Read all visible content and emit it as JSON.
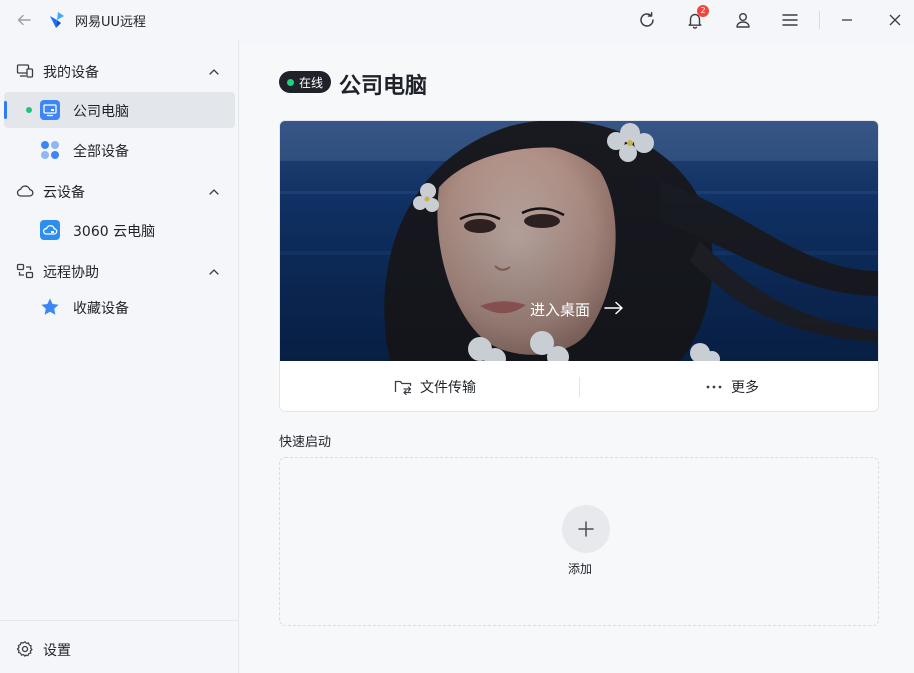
{
  "app": {
    "title": "网易UU远程"
  },
  "titlebar": {
    "notification_count": "2",
    "icons": [
      "back-arrow-icon",
      "refresh-icon",
      "bell-icon",
      "user-icon",
      "menu-icon",
      "minimize-icon",
      "close-icon"
    ]
  },
  "sidebar": {
    "my_devices": {
      "label": "我的设备",
      "items": [
        {
          "label": "公司电脑",
          "online": true,
          "active": true
        },
        {
          "label": "全部设备"
        }
      ]
    },
    "cloud_devices": {
      "label": "云设备",
      "items": [
        {
          "label": "3060 云电脑"
        }
      ]
    },
    "remote_assist": {
      "label": "远程协助",
      "items": [
        {
          "label": "收藏设备"
        }
      ]
    },
    "settings_label": "设置"
  },
  "main": {
    "status": "在线",
    "device_name": "公司电脑",
    "enter_desktop": "进入桌面",
    "file_transfer": "文件传输",
    "more": "更多",
    "quick_launch_label": "快速启动",
    "add_label": "添加"
  },
  "colors": {
    "accent": "#2f7bf5",
    "online": "#21d27e",
    "badge": "#f2453d"
  }
}
